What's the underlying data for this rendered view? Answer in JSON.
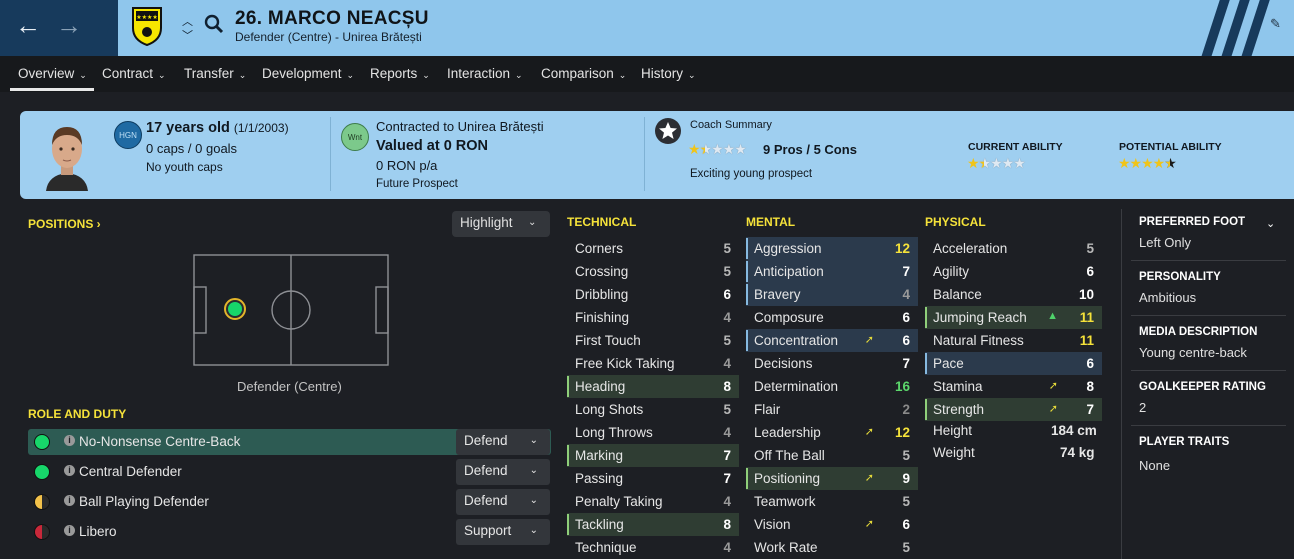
{
  "player": {
    "title": "26. MARCO NEACȘU",
    "subtitle": "Defender (Centre) - Unirea Brătești"
  },
  "tabs": [
    "Overview",
    "Contract",
    "Transfer",
    "Development",
    "Reports",
    "Interaction",
    "Comparison",
    "History"
  ],
  "summary": {
    "age": "17 years old",
    "dob": "(1/1/2003)",
    "caps": "0 caps / 0 goals",
    "youth_caps": "No youth caps",
    "nation_badge": "HGN",
    "contract_badge": "Wnt",
    "contracted_to": "Contracted to Unirea Brătești",
    "valued": "Valued at 0 RON",
    "wage": "0 RON p/a",
    "status": "Future Prospect",
    "coach_label": "Coach Summary",
    "pros_cons": "9 Pros / 5 Cons",
    "coach_stars": 1.5,
    "coach_note": "Exciting young prospect",
    "current_ability_label": "CURRENT ABILITY",
    "current_ability_stars": 1.5,
    "potential_ability_label": "POTENTIAL ABILITY",
    "potential_ability_stars": 4.5
  },
  "positions": {
    "label": "POSITIONS ›",
    "highlight": "Highlight",
    "position_name": "Defender (Centre)"
  },
  "role_duty": {
    "label": "ROLE AND DUTY",
    "roles": [
      {
        "name": "No-Nonsense Centre-Back",
        "duty": "Defend",
        "dot": "#17d66a"
      },
      {
        "name": "Central Defender",
        "duty": "Defend",
        "dot": "#17d66a"
      },
      {
        "name": "Ball Playing Defender",
        "duty": "Defend",
        "dot": "half-yellow"
      },
      {
        "name": "Libero",
        "duty": "Support",
        "dot": "half-red"
      }
    ]
  },
  "attributes": {
    "technical_label": "TECHNICAL",
    "mental_label": "MENTAL",
    "physical_label": "PHYSICAL",
    "technical": [
      {
        "name": "Corners",
        "value": 5
      },
      {
        "name": "Crossing",
        "value": 5
      },
      {
        "name": "Dribbling",
        "value": 6
      },
      {
        "name": "Finishing",
        "value": 4
      },
      {
        "name": "First Touch",
        "value": 5
      },
      {
        "name": "Free Kick Taking",
        "value": 4
      },
      {
        "name": "Heading",
        "value": 8,
        "hl": "g"
      },
      {
        "name": "Long Shots",
        "value": 5
      },
      {
        "name": "Long Throws",
        "value": 4
      },
      {
        "name": "Marking",
        "value": 7,
        "hl": "g"
      },
      {
        "name": "Passing",
        "value": 7
      },
      {
        "name": "Penalty Taking",
        "value": 4
      },
      {
        "name": "Tackling",
        "value": 8,
        "hl": "g"
      },
      {
        "name": "Technique",
        "value": 4
      }
    ],
    "mental": [
      {
        "name": "Aggression",
        "value": 12,
        "hl": "b"
      },
      {
        "name": "Anticipation",
        "value": 7,
        "hl": "b"
      },
      {
        "name": "Bravery",
        "value": 4,
        "hl": "b"
      },
      {
        "name": "Composure",
        "value": 6
      },
      {
        "name": "Concentration",
        "value": 6,
        "hl": "b",
        "arrow": "up-right"
      },
      {
        "name": "Decisions",
        "value": 7
      },
      {
        "name": "Determination",
        "value": 16
      },
      {
        "name": "Flair",
        "value": 2
      },
      {
        "name": "Leadership",
        "value": 12,
        "arrow": "up-right"
      },
      {
        "name": "Off The Ball",
        "value": 5
      },
      {
        "name": "Positioning",
        "value": 9,
        "hl": "g",
        "arrow": "up-right"
      },
      {
        "name": "Teamwork",
        "value": 5
      },
      {
        "name": "Vision",
        "value": 6,
        "arrow": "up-right"
      },
      {
        "name": "Work Rate",
        "value": 5
      }
    ],
    "physical": [
      {
        "name": "Acceleration",
        "value": 5
      },
      {
        "name": "Agility",
        "value": 6
      },
      {
        "name": "Balance",
        "value": 10
      },
      {
        "name": "Jumping Reach",
        "value": 11,
        "hl": "g",
        "arrow": "up"
      },
      {
        "name": "Natural Fitness",
        "value": 11
      },
      {
        "name": "Pace",
        "value": 6,
        "hl": "b"
      },
      {
        "name": "Stamina",
        "value": 8,
        "arrow": "up-right"
      },
      {
        "name": "Strength",
        "value": 7,
        "hl": "g",
        "arrow": "up-right"
      }
    ],
    "height_label": "Height",
    "height": "184 cm",
    "weight_label": "Weight",
    "weight": "74 kg"
  },
  "info": {
    "foot_label": "PREFERRED FOOT",
    "foot": "Left Only",
    "personality_label": "PERSONALITY",
    "personality": "Ambitious",
    "media_label": "MEDIA DESCRIPTION",
    "media": "Young centre-back",
    "gk_label": "GOALKEEPER RATING",
    "gk": "2",
    "traits_label": "PLAYER TRAITS",
    "traits": "None"
  }
}
